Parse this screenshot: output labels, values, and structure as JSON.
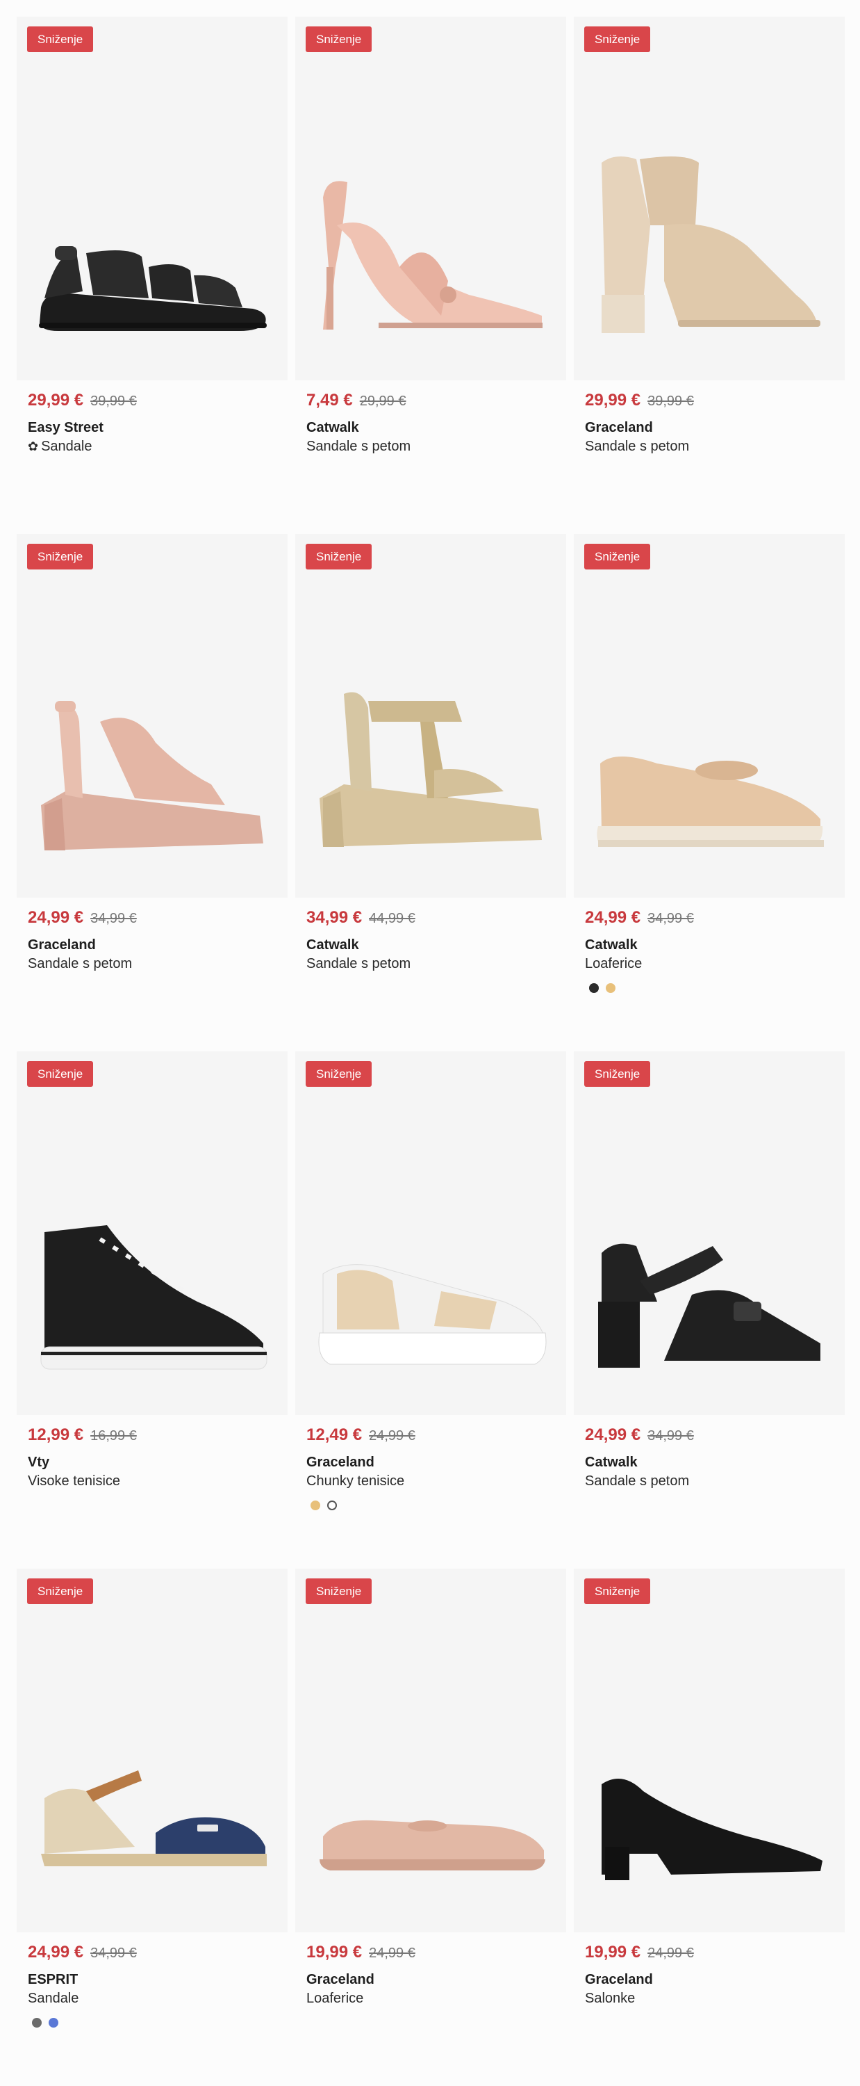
{
  "products": [
    {
      "badge": "Sniženje",
      "price": "29,99 €",
      "old_price": "39,99 €",
      "brand": "Easy Street",
      "type": "Sandale",
      "eco_icon": "eco-sustainability-icon",
      "swatches": []
    },
    {
      "badge": "Sniženje",
      "price": "7,49 €",
      "old_price": "29,99 €",
      "brand": "Catwalk",
      "type": "Sandale s petom",
      "swatches": []
    },
    {
      "badge": "Sniženje",
      "price": "29,99 €",
      "old_price": "39,99 €",
      "brand": "Graceland",
      "type": "Sandale s petom",
      "swatches": []
    },
    {
      "badge": "Sniženje",
      "price": "24,99 €",
      "old_price": "34,99 €",
      "brand": "Graceland",
      "type": "Sandale s petom",
      "swatches": []
    },
    {
      "badge": "Sniženje",
      "price": "34,99 €",
      "old_price": "44,99 €",
      "brand": "Catwalk",
      "type": "Sandale s petom",
      "swatches": []
    },
    {
      "badge": "Sniženje",
      "price": "24,99 €",
      "old_price": "34,99 €",
      "brand": "Catwalk",
      "type": "Loaferice",
      "swatches": [
        "#2b2b2b",
        "#e8c07a"
      ]
    },
    {
      "badge": "Sniženje",
      "price": "12,99 €",
      "old_price": "16,99 €",
      "brand": "Vty",
      "type": "Visoke tenisice",
      "swatches": []
    },
    {
      "badge": "Sniženje",
      "price": "12,49 €",
      "old_price": "24,99 €",
      "brand": "Graceland",
      "type": "Chunky tenisice",
      "swatches": [
        "#e8c07a",
        "#ffffff"
      ]
    },
    {
      "badge": "Sniženje",
      "price": "24,99 €",
      "old_price": "34,99 €",
      "brand": "Catwalk",
      "type": "Sandale s petom",
      "swatches": []
    },
    {
      "badge": "Sniženje",
      "price": "24,99 €",
      "old_price": "34,99 €",
      "brand": "ESPRIT",
      "type": "Sandale",
      "swatches": [
        "#6b6b6b",
        "#5a78d6"
      ]
    },
    {
      "badge": "Sniženje",
      "price": "19,99 €",
      "old_price": "24,99 €",
      "brand": "Graceland",
      "type": "Loaferice",
      "swatches": []
    },
    {
      "badge": "Sniženje",
      "price": "19,99 €",
      "old_price": "24,99 €",
      "brand": "Graceland",
      "type": "Salonke",
      "swatches": []
    }
  ],
  "colors": {
    "sale_badge": "#d9464a",
    "price_now": "#c8393d",
    "image_bg": "#f5f5f5"
  }
}
